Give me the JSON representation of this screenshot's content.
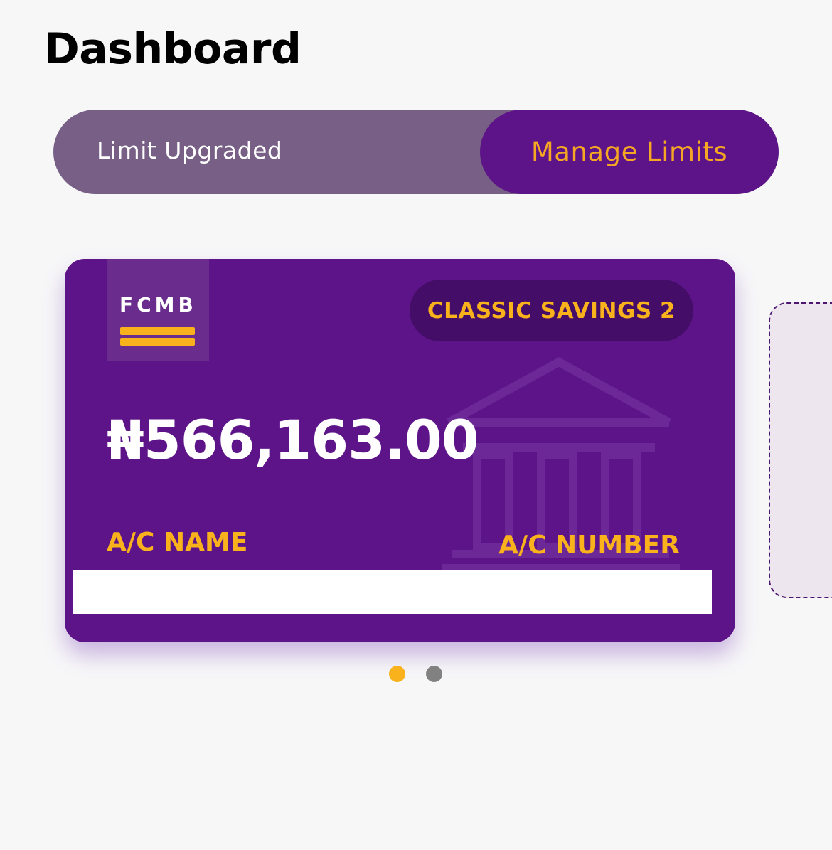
{
  "header": {
    "title": "Dashboard"
  },
  "limit_banner": {
    "status_text": "Limit Upgraded",
    "manage_label": "Manage Limits"
  },
  "account_card": {
    "logo_text": "FCMB",
    "account_type": "CLASSIC SAVINGS 2",
    "balance": "₦566,163.00",
    "account_name_label": "A/C NAME",
    "account_number_label": "A/C NUMBER",
    "background_color": "#5e1489",
    "accent_color": "#f9b21b"
  },
  "carousel": {
    "total_pages": 2,
    "active_index": 0
  },
  "colors": {
    "primary_purple": "#5e1489",
    "banner_muted_purple": "#775f86",
    "accent_gold": "#f9b21b",
    "inactive_dot": "#818181"
  }
}
